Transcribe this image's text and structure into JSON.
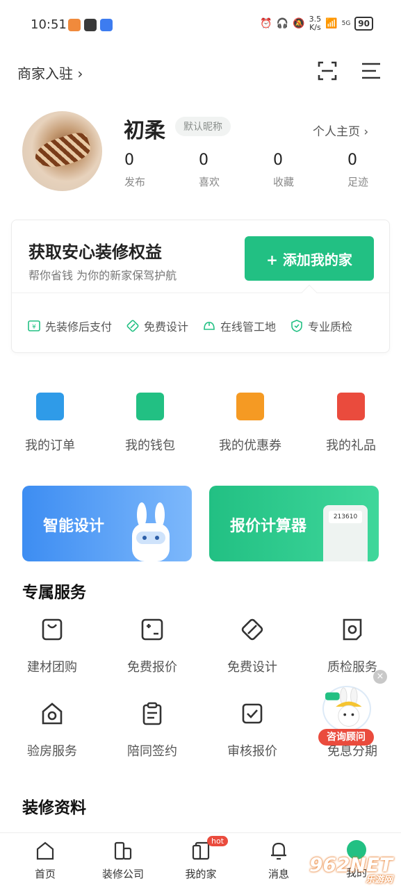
{
  "status_bar": {
    "time": "10:51",
    "speed_value": "3.5",
    "speed_unit": "K/s",
    "network": "5G",
    "battery": "90"
  },
  "header": {
    "merchant_entry": "商家入驻 ›"
  },
  "profile": {
    "nickname": "初柔",
    "nickname_tag": "默认昵称",
    "homepage_link": "个人主页 ›",
    "stats": [
      {
        "value": "0",
        "label": "发布"
      },
      {
        "value": "0",
        "label": "喜欢"
      },
      {
        "value": "0",
        "label": "收藏"
      },
      {
        "value": "0",
        "label": "足迹"
      }
    ]
  },
  "benefit_card": {
    "title": "获取安心装修权益",
    "subtitle": "帮你省钱  为你的新家保驾护航",
    "button": "+ 添加我的家",
    "perks": [
      "先装修后支付",
      "免费设计",
      "在线管工地",
      "专业质检"
    ]
  },
  "quick_actions": [
    {
      "label": "我的订单",
      "icon": "order-icon",
      "color": "#2f9be8"
    },
    {
      "label": "我的钱包",
      "icon": "wallet-icon",
      "color": "#22c083"
    },
    {
      "label": "我的优惠券",
      "icon": "coupon-icon",
      "color": "#f59a23"
    },
    {
      "label": "我的礼品",
      "icon": "gift-icon",
      "color": "#ea4b3d"
    }
  ],
  "banners": {
    "smart_design": "智能设计",
    "quote_calculator": "报价计算器",
    "calculator_display": "213610"
  },
  "exclusive_services": {
    "title": "专属服务",
    "items": [
      {
        "label": "建材团购",
        "icon": "shopping-bag-icon"
      },
      {
        "label": "免费报价",
        "icon": "quote-calculator-icon"
      },
      {
        "label": "免费设计",
        "icon": "design-ruler-icon"
      },
      {
        "label": "质检服务",
        "icon": "inspection-icon"
      },
      {
        "label": "验房服务",
        "icon": "house-search-icon"
      },
      {
        "label": "陪同签约",
        "icon": "clipboard-icon"
      },
      {
        "label": "审核报价",
        "icon": "checkbox-icon"
      },
      {
        "label": "免息分期",
        "icon": "installment-icon"
      }
    ]
  },
  "materials": {
    "title": "装修资料"
  },
  "advisor_float": {
    "label": "咨询顾问",
    "close": "×"
  },
  "bottom_nav": [
    {
      "label": "首页",
      "icon": "home-icon"
    },
    {
      "label": "装修公司",
      "icon": "company-icon"
    },
    {
      "label": "我的家",
      "icon": "my-home-icon",
      "badge": "hot"
    },
    {
      "label": "消息",
      "icon": "bell-icon"
    },
    {
      "label": "我的",
      "icon": "profile-icon"
    }
  ],
  "watermark": {
    "main": "962NET",
    "sub": "乐游网"
  },
  "colors": {
    "brand_green": "#22c083",
    "accent_red": "#ea4b3d",
    "blue": "#3d8df2"
  }
}
